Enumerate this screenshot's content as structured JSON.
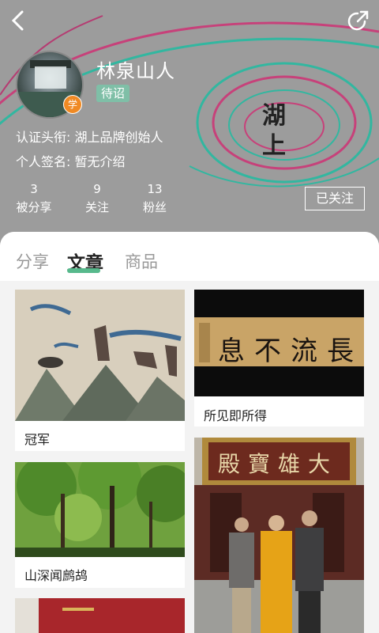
{
  "profile": {
    "name": "林泉山人",
    "level": "待诏",
    "badge": "学",
    "title_line": "认证头衔: 湖上品牌创始人",
    "signature_line": "个人签名: 暂无介绍",
    "header_art_text": "湖上",
    "stats": [
      {
        "value": "3",
        "label": "被分享"
      },
      {
        "value": "9",
        "label": "关注"
      },
      {
        "value": "13",
        "label": "粉丝"
      }
    ],
    "follow_button": "已关注"
  },
  "tabs": [
    {
      "label": "分享"
    },
    {
      "label": "文章"
    },
    {
      "label": "商品"
    }
  ],
  "active_tab": "文章",
  "cards": [
    {
      "caption": "冠军"
    },
    {
      "caption": "所见即所得",
      "calligraphy": "長流不息"
    },
    {
      "caption": "山深闻鹧鸪"
    },
    {
      "caption": "",
      "plaque": "大雄寶殿"
    }
  ],
  "colors": {
    "header_bg": "#9c9c9c",
    "accent_green": "#57b98c",
    "badge_orange": "#f08a24"
  },
  "icons": {
    "back": "chevron-left-icon",
    "share": "share-icon"
  }
}
